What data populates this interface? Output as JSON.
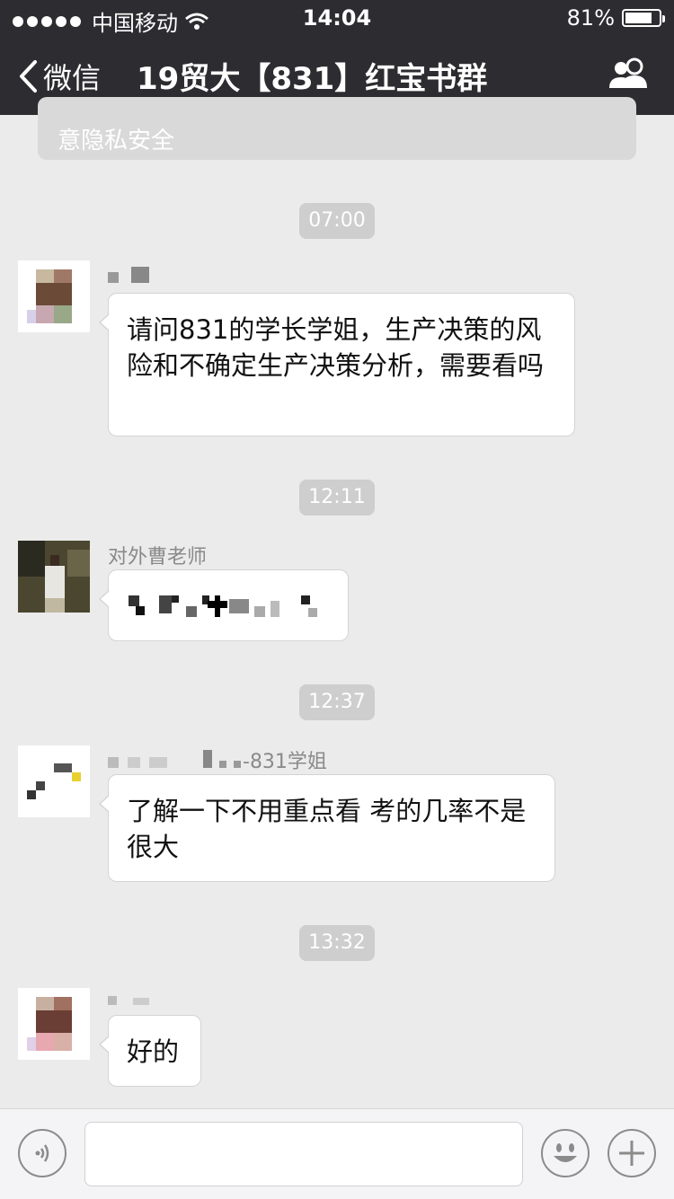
{
  "status_bar": {
    "carrier": "中国移动",
    "time": "14:04",
    "battery_percent": "81%",
    "battery_level": 0.81
  },
  "nav": {
    "back_label": "微信",
    "title": "19贸大【831】红宝书群",
    "members_icon": "group-members-icon"
  },
  "notice": {
    "text": "意隐私安全"
  },
  "messages": [
    {
      "time": "07:00",
      "sender": "",
      "text": "请问831的学长学姐，生产决策的风险和不确定生产决策分析，需要看吗"
    },
    {
      "time": "12:11",
      "sender": "对外曹老师",
      "text": ""
    },
    {
      "time": "12:37",
      "sender": "-831学姐",
      "text": "了解一下不用重点看 考的几率不是很大"
    },
    {
      "time": "13:32",
      "sender": "",
      "text": "好的"
    }
  ],
  "toolbar": {
    "voice_icon": "voice-icon",
    "emoji_icon": "emoji-icon",
    "plus_icon": "plus-icon",
    "input_value": ""
  }
}
